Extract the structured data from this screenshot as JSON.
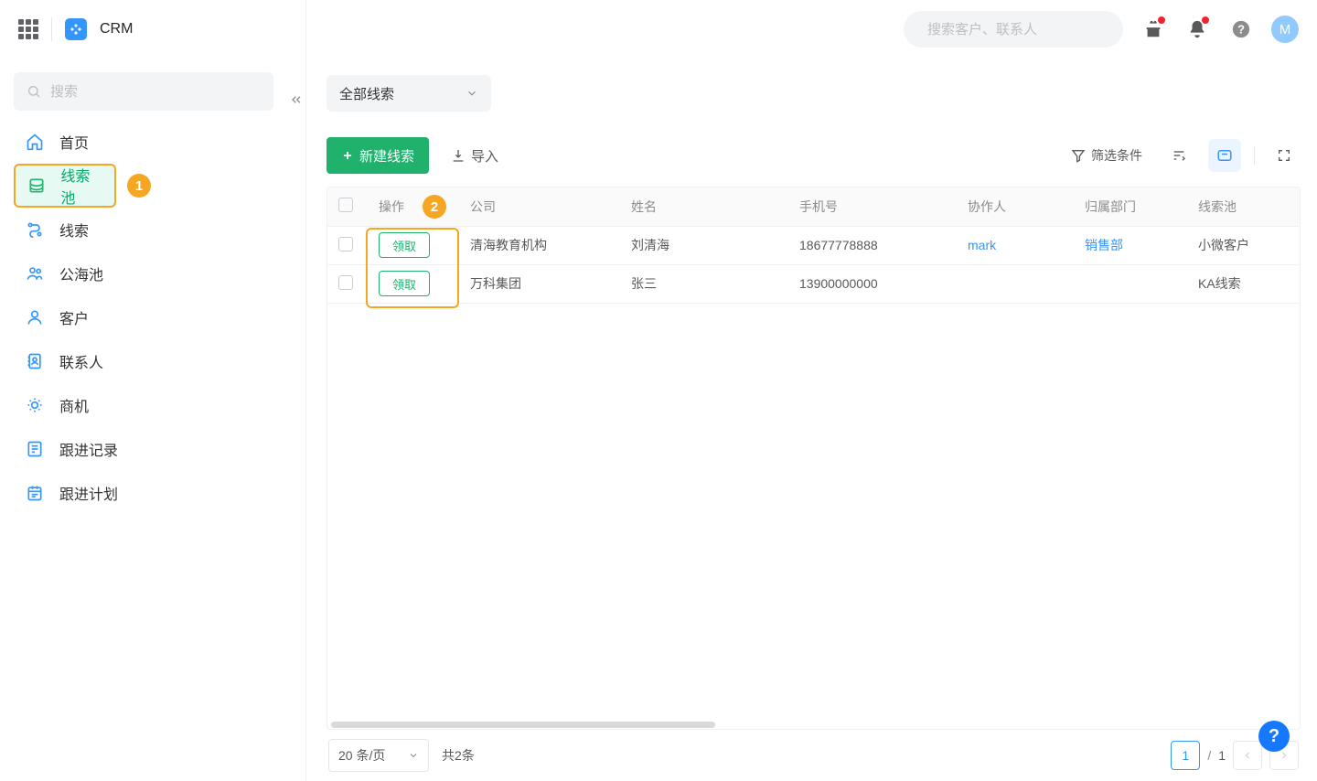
{
  "app": {
    "name": "CRM",
    "avatar_letter": "M"
  },
  "search": {
    "global_placeholder": "搜索客户、联系人",
    "side_placeholder": "搜索"
  },
  "nav": [
    {
      "icon": "home",
      "label": "首页"
    },
    {
      "icon": "layers",
      "label": "线索池",
      "active": true,
      "highlight": "1"
    },
    {
      "icon": "route",
      "label": "线索"
    },
    {
      "icon": "pool",
      "label": "公海池"
    },
    {
      "icon": "person",
      "label": "客户"
    },
    {
      "icon": "contact",
      "label": "联系人"
    },
    {
      "icon": "bulb",
      "label": "商机"
    },
    {
      "icon": "record",
      "label": "跟进记录"
    },
    {
      "icon": "calendar",
      "label": "跟进计划"
    }
  ],
  "filter": {
    "current": "全部线索"
  },
  "actions": {
    "new_lead": "新建线索",
    "import": "导入",
    "claim": "领取",
    "filter": "筛选条件"
  },
  "annotations": {
    "op_badge": "2"
  },
  "table": {
    "columns": [
      "操作",
      "公司",
      "姓名",
      "手机号",
      "协作人",
      "归属部门",
      "线索池"
    ],
    "rows": [
      {
        "company": "清海教育机构",
        "name": "刘清海",
        "phone": "18677778888",
        "collaborator": "mark",
        "dept": "销售部",
        "pool": "小微客户"
      },
      {
        "company": "万科集团",
        "name": "张三",
        "phone": "13900000000",
        "collaborator": "",
        "dept": "",
        "pool": "KA线索"
      }
    ]
  },
  "pagination": {
    "page_size_label": "20 条/页",
    "total_label": "共2条",
    "current": "1",
    "total_pages": "1",
    "sep": "/"
  }
}
